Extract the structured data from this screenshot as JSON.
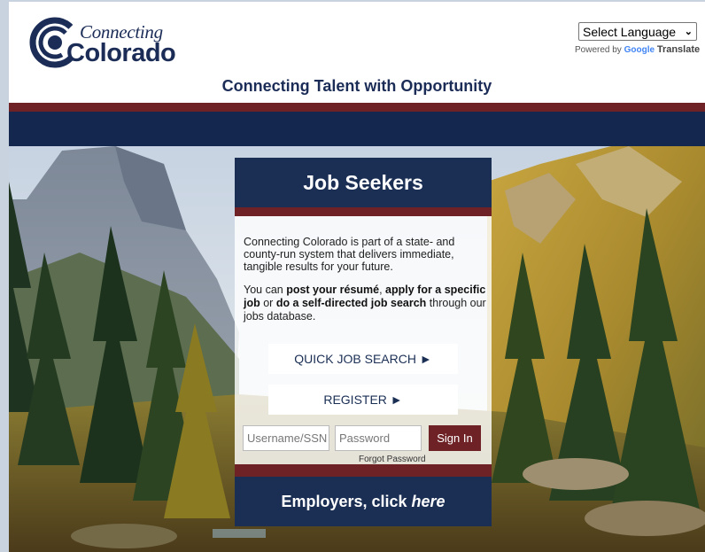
{
  "header": {
    "logo_line1": "Connecting",
    "logo_line2": "Colorado",
    "tagline": "Connecting Talent with Opportunity"
  },
  "translate": {
    "selected": "Select Language",
    "powered_by": "Powered by",
    "google": "Google",
    "translate": "Translate"
  },
  "panel": {
    "title": "Job Seekers",
    "intro": "Connecting Colorado is part of a state- and county-run system that delivers immediate, tangible results for your future.",
    "intro2_a": "You can ",
    "intro2_b": "post your résumé",
    "intro2_c": ", ",
    "intro2_d": "apply for a specific job",
    "intro2_e": " or ",
    "intro2_f": "do a self-directed job search",
    "intro2_g": " through our jobs database.",
    "quick_search_label": "QUICK JOB SEARCH ►",
    "register_label": "REGISTER ►",
    "username_placeholder": "Username/SSN",
    "password_placeholder": "Password",
    "signin_label": "Sign In",
    "forgot_label": "Forgot Password",
    "employers_a": "Employers, click",
    "employers_b": "here"
  },
  "colors": {
    "navy": "#1b2f55",
    "maroon": "#6e2225"
  }
}
